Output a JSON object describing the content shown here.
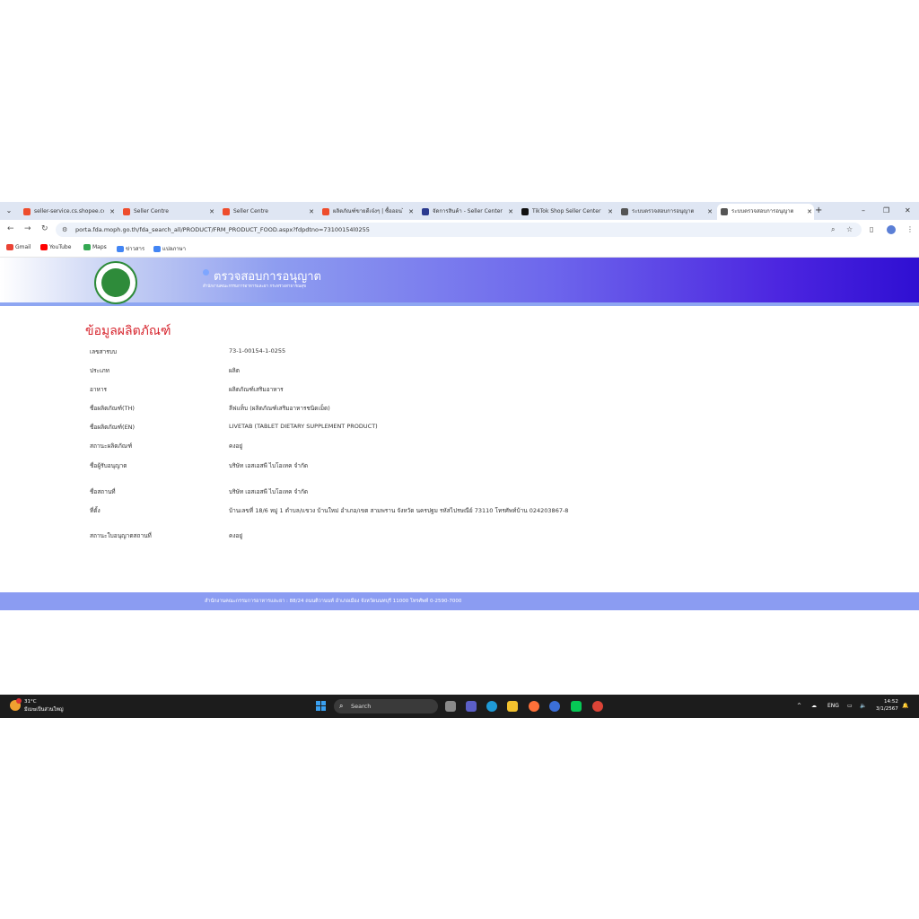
{
  "browser": {
    "tabs": [
      {
        "label": "seller-service.cs.shopee.co",
        "color": "#ee4d2d"
      },
      {
        "label": "Seller Centre",
        "color": "#ee4d2d"
      },
      {
        "label": "Seller Centre",
        "color": "#ee4d2d"
      },
      {
        "label": "ผลิตภัณฑ์ขายดีเจ๋งๆ | ซื้อออนไ",
        "color": "#ee4d2d"
      },
      {
        "label": "จัดการสินค้า - Seller Center",
        "color": "#2b3a8f"
      },
      {
        "label": "TikTok Shop Seller Center",
        "color": "#111111"
      },
      {
        "label": "ระบบตรวจสอบการอนุญาต",
        "color": "#555555"
      },
      {
        "label": "ระบบตรวจสอบการอนุญาต",
        "color": "#555555"
      }
    ],
    "active_tab_index": 7,
    "url": "porta.fda.moph.go.th/fda_search_all/PRODUCT/FRM_PRODUCT_FOOD.aspx?fdpdtno=73100154l0255",
    "bookmarks": [
      {
        "label": "Gmail",
        "color": "#ea4335"
      },
      {
        "label": "YouTube",
        "color": "#ff0000"
      },
      {
        "label": "Maps",
        "color": "#34a853"
      },
      {
        "label": "ข่าวสาร",
        "color": "#4285f4"
      },
      {
        "label": "แปลภาษา",
        "color": "#4285f4"
      }
    ]
  },
  "site": {
    "title": "ตรวจสอบการอนุญาต",
    "subtitle": "สำนักงานคณะกรรมการอาหารและยา กระทรวงสาธารณสุข",
    "footer": "สำนักงานคณะกรรมการอาหารและยา : 88/24 ถนนติวานนท์ อำเภอเมือง จังหวัดนนทบุรี 11000 โทรศัพท์ 0-2590-7000"
  },
  "product": {
    "heading": "ข้อมูลผลิตภัณฑ์",
    "rows": [
      {
        "label": "เลขสารบบ",
        "value": "73-1-00154-1-0255"
      },
      {
        "label": "ประเภท",
        "value": "ผลิต"
      },
      {
        "label": "อาหาร",
        "value": "ผลิตภัณฑ์เสริมอาหาร"
      },
      {
        "label": "ชื่อผลิตภัณฑ์(TH)",
        "value": "ลีฟแท็บ (ผลิตภัณฑ์เสริมอาหารชนิดเม็ด)"
      },
      {
        "label": "ชื่อผลิตภัณฑ์(EN)",
        "value": "LIVETAB (TABLET DIETARY SUPPLEMENT PRODUCT)"
      },
      {
        "label": "สถานะผลิตภัณฑ์",
        "value": "คงอยู่"
      },
      {
        "label": "ชื่อผู้รับอนุญาต",
        "value": "บริษัท เอสเอสพี ไบโอเทค จำกัด"
      },
      {
        "label": "ชื่อสถานที่",
        "value": "บริษัท เอสเอสพี ไบโอเทค จำกัด"
      },
      {
        "label": "ที่ตั้ง",
        "value": "บ้านเลขที่ 18/6 หมู่ 1 ตำบล/แขวง บ้านใหม่ อำเภอ/เขต สามพราน จังหวัด นครปฐม รหัสไปรษณีย์ 73110 โทรศัพท์บ้าน 024203867-8"
      },
      {
        "label": "สถานะใบอนุญาตสถานที่",
        "value": "คงอยู่"
      }
    ]
  },
  "taskbar": {
    "weather_temp": "31°C",
    "weather_desc": "มีเมฆเป็นส่วนใหญ่",
    "search_placeholder": "Search",
    "language": "ENG",
    "time": "14:52",
    "date": "3/1/2567"
  }
}
